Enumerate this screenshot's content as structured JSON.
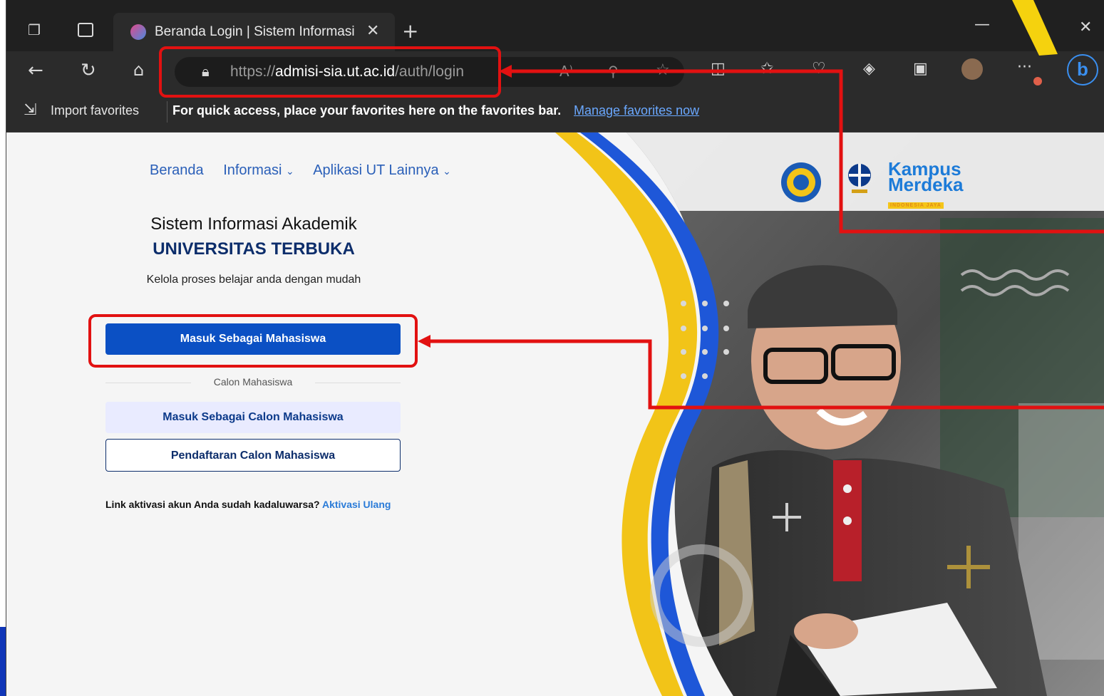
{
  "browser": {
    "tab_title": "Beranda Login | Sistem Informasi",
    "url_prefix": "https://",
    "url_host": "admisi-sia.ut.ac.id",
    "url_path": "/auth/login",
    "favorites": {
      "import_label": "Import favorites",
      "hint_text": "For quick access, place your favorites here on the favorites bar.",
      "manage_link": "Manage favorites now"
    },
    "icons": [
      "collections-icon",
      "tab-actions-icon",
      "back-icon",
      "refresh-icon",
      "home-icon",
      "lock-icon",
      "read-aloud-icon",
      "zoom-icon",
      "favorite-star-icon",
      "split-screen-icon",
      "favorites-icon",
      "browser-essentials-icon",
      "copilot-icon",
      "collections-icon",
      "profile-avatar",
      "more-icon",
      "bing-icon",
      "minimize-icon",
      "close-icon"
    ]
  },
  "page": {
    "nav": {
      "home": "Beranda",
      "info": "Informasi",
      "other_apps": "Aplikasi UT Lainnya"
    },
    "title_line1": "Sistem Informasi Akademik",
    "title_line2": "UNIVERSITAS TERBUKA",
    "tagline": "Kelola proses belajar anda dengan mudah",
    "btn_student": "Masuk Sebagai Mahasiswa",
    "divider_label": "Calon Mahasiswa",
    "btn_prospective": "Masuk Sebagai Calon Mahasiswa",
    "btn_register": "Pendaftaran Calon Mahasiswa",
    "activation_text": "Link aktivasi akun Anda sudah kadaluwarsa?",
    "activation_link": "Aktivasi Ulang",
    "logo_kampus": "Kampus\nMerdeka",
    "logo_kampus_sub": "INDONESIA JAYA"
  },
  "colors": {
    "primary_blue": "#0b50c4",
    "annotation_red": "#e21111",
    "accent_yellow": "#f5c518"
  }
}
